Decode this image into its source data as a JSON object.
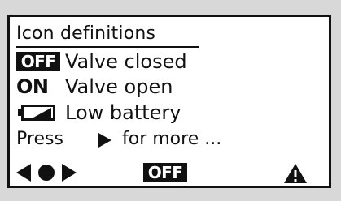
{
  "screen": {
    "title": "Icon definitions",
    "definitions": [
      {
        "icon": "off-badge",
        "icon_text": "OFF",
        "label": "Valve closed"
      },
      {
        "icon": "on-text",
        "icon_text": "ON",
        "label": "Valve open"
      },
      {
        "icon": "low-battery-icon",
        "label": "Low battery"
      }
    ],
    "hint": {
      "prefix": "Press",
      "icon": "right-arrow-icon",
      "suffix": "for more ..."
    },
    "nav_bar": {
      "left_icon": "left-dot-right-nav-icon",
      "status_badge": "OFF",
      "right_icon": "warning-icon"
    }
  },
  "colors": {
    "background": "#d8d8d8",
    "screen": "#ffffff",
    "foreground": "#111111"
  }
}
